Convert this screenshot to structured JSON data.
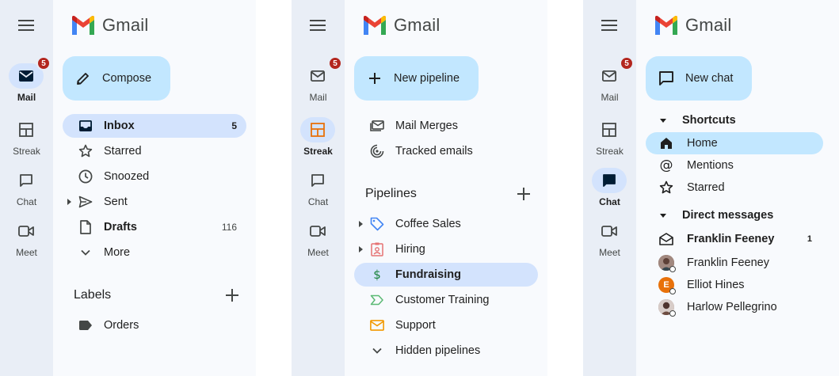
{
  "rail": {
    "mail_label": "Mail",
    "mail_badge": "5",
    "streak_label": "Streak",
    "chat_label": "Chat",
    "meet_label": "Meet"
  },
  "logo": {
    "text": "Gmail"
  },
  "panel1": {
    "compose_label": "Compose",
    "nav": [
      {
        "label": "Inbox",
        "count": "5",
        "icon": "inbox-icon"
      },
      {
        "label": "Starred",
        "icon": "star-icon"
      },
      {
        "label": "Snoozed",
        "icon": "clock-icon"
      },
      {
        "label": "Sent",
        "icon": "send-icon"
      },
      {
        "label": "Drafts",
        "count": "116",
        "icon": "draft-icon"
      },
      {
        "label": "More",
        "icon": "chevron-down-icon"
      }
    ],
    "labels_heading": "Labels",
    "labels": [
      {
        "label": "Orders",
        "icon": "label-icon"
      }
    ]
  },
  "panel2": {
    "fab_label": "New pipeline",
    "items": [
      {
        "label": "Mail Merges",
        "icon": "mail-merge-icon"
      },
      {
        "label": "Tracked emails",
        "icon": "tracked-icon"
      }
    ],
    "pipelines_heading": "Pipelines",
    "pipelines": [
      {
        "label": "Coffee Sales",
        "icon": "tag-icon",
        "color": "#4285f4"
      },
      {
        "label": "Hiring",
        "icon": "badge-icon",
        "color": "#e57373"
      },
      {
        "label": "Fundraising",
        "icon": "dollar-icon",
        "color": "#188038"
      },
      {
        "label": "Customer Training",
        "icon": "chevron-arrow-icon",
        "color": "#5bb974"
      },
      {
        "label": "Support",
        "icon": "envelope-icon",
        "color": "#f29900"
      },
      {
        "label": "Hidden pipelines",
        "icon": "chevron-down-icon"
      }
    ]
  },
  "panel3": {
    "fab_label": "New chat",
    "shortcuts_heading": "Shortcuts",
    "shortcuts": [
      {
        "label": "Home",
        "icon": "home-icon"
      },
      {
        "label": "Mentions",
        "icon": "at-icon"
      },
      {
        "label": "Starred",
        "icon": "star-icon"
      }
    ],
    "dm_heading": "Direct messages",
    "dms": [
      {
        "label": "Franklin Feeney",
        "count": "1",
        "icon": "envelope-open-icon"
      },
      {
        "label": "Franklin Feeney",
        "avatar_color": "#6d4c41"
      },
      {
        "label": "Elliot Hines",
        "avatar_letter": "E",
        "avatar_color": "#e8710a"
      },
      {
        "label": "Harlow Pellegrino",
        "avatar_color": "#8d6e63"
      }
    ]
  },
  "colors": {
    "rail_bg": "#e9eef6",
    "side_bg": "#f8fafd",
    "active_pill": "#d3e3fd",
    "fab_bg": "#c2e7ff",
    "badge_red": "#b3261e"
  }
}
